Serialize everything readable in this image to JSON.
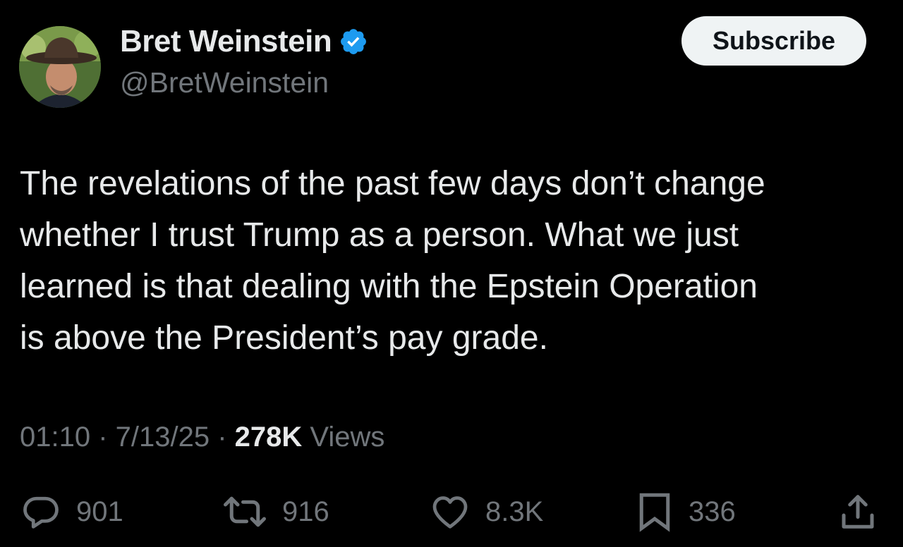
{
  "author": {
    "display_name": "Bret Weinstein",
    "handle": "@BretWeinstein",
    "verified_icon": "verified-badge-icon",
    "verified_color": "#1d9bf0"
  },
  "header": {
    "subscribe_label": "Subscribe"
  },
  "tweet": {
    "lines": [
      "The revelations of the past few days don’t change",
      "whether I trust Trump as a person. What we just",
      "learned is that dealing with the Epstein Operation",
      "is above the President’s pay grade."
    ]
  },
  "meta": {
    "time": "01:10",
    "sep1": " · ",
    "date": "7/13/25",
    "sep2": " · ",
    "views_count": "278K",
    "views_label": " Views"
  },
  "actions": {
    "replies": {
      "icon": "reply-icon",
      "count": "901"
    },
    "reposts": {
      "icon": "repost-icon",
      "count": "916"
    },
    "likes": {
      "icon": "heart-icon",
      "count": "8.3K"
    },
    "bookmarks": {
      "icon": "bookmark-icon",
      "count": "336"
    },
    "share": {
      "icon": "share-icon"
    }
  },
  "colors": {
    "background": "#000000",
    "primary_text": "#e7e9ea",
    "secondary_text": "#71767b",
    "subscribe_bg": "#eff3f4"
  }
}
